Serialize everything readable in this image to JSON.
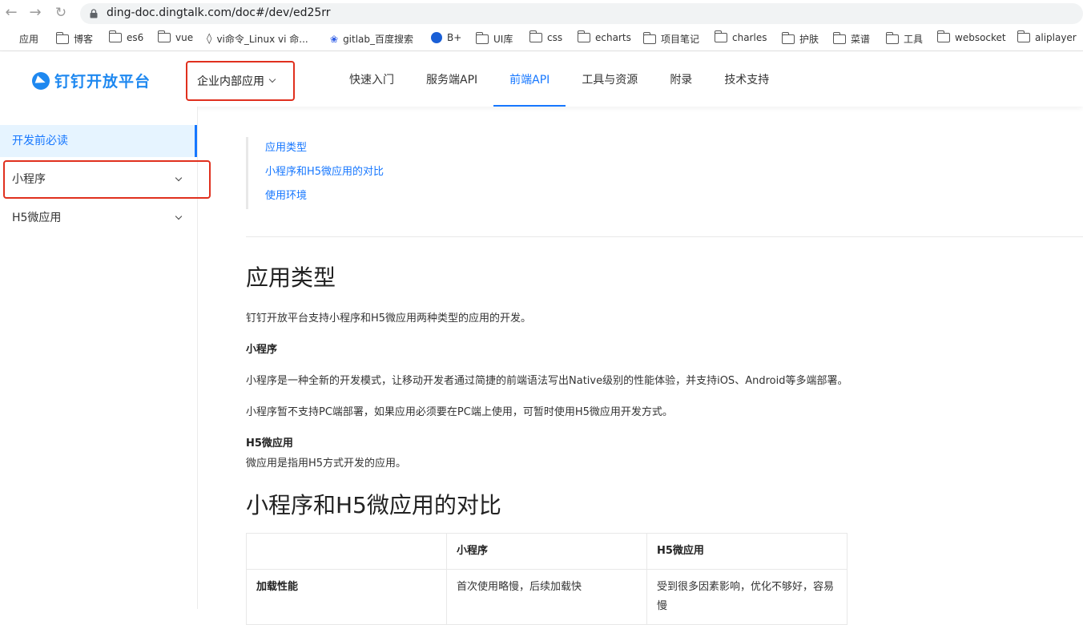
{
  "browser": {
    "url": "ding-doc.dingtalk.com/doc#/dev/ed25rr",
    "bookmarks": [
      {
        "label": "应用",
        "icon": "apps-icon"
      },
      {
        "label": "博客",
        "icon": "folder-icon"
      },
      {
        "label": "es6",
        "icon": "folder-icon"
      },
      {
        "label": "vue",
        "icon": "folder-icon"
      },
      {
        "label": "vi命令_Linux vi 命...",
        "icon": "diamond-icon"
      },
      {
        "label": "gitlab_百度搜索",
        "icon": "baidu-paw-icon"
      },
      {
        "label": "B+",
        "icon": "globe-icon"
      },
      {
        "label": "UI库",
        "icon": "folder-icon"
      },
      {
        "label": "css",
        "icon": "folder-icon"
      },
      {
        "label": "echarts",
        "icon": "folder-icon"
      },
      {
        "label": "项目笔记",
        "icon": "folder-icon"
      },
      {
        "label": "charles",
        "icon": "folder-icon"
      },
      {
        "label": "护肤",
        "icon": "folder-icon"
      },
      {
        "label": "菜谱",
        "icon": "folder-icon"
      },
      {
        "label": "工具",
        "icon": "folder-icon"
      },
      {
        "label": "websocket",
        "icon": "folder-icon"
      },
      {
        "label": "aliplayer",
        "icon": "folder-icon"
      }
    ]
  },
  "header": {
    "logo_text": "钉钉开放平台",
    "app_type": "企业内部应用",
    "nav": [
      {
        "label": "快速入门",
        "active": false
      },
      {
        "label": "服务端API",
        "active": false
      },
      {
        "label": "前端API",
        "active": true
      },
      {
        "label": "工具与资源",
        "active": false
      },
      {
        "label": "附录",
        "active": false
      },
      {
        "label": "技术支持",
        "active": false
      }
    ]
  },
  "sidebar": {
    "items": [
      {
        "label": "开发前必读",
        "active": true
      },
      {
        "label": "小程序",
        "expandable": true
      },
      {
        "label": "H5微应用",
        "expandable": true
      }
    ]
  },
  "content": {
    "toc": [
      "应用类型",
      "小程序和H5微应用的对比",
      "使用环境"
    ],
    "section1_title": "应用类型",
    "section1_intro": "钉钉开放平台支持小程序和H5微应用两种类型的应用的开发。",
    "mini_heading": "小程序",
    "mini_p1": "小程序是一种全新的开发模式，让移动开发者通过简捷的前端语法写出Native级别的性能体验，并支持iOS、Android等多端部署。",
    "mini_p2": "小程序暂不支持PC端部署，如果应用必须要在PC端上使用，可暂时使用H5微应用开发方式。",
    "h5_heading": "H5微应用",
    "h5_p1": "微应用是指用H5方式开发的应用。",
    "section2_title": "小程序和H5微应用的对比",
    "table": {
      "headers": [
        "",
        "小程序",
        "H5微应用"
      ],
      "rows": [
        [
          "加载性能",
          "首次使用略慢，后续加载快",
          "受到很多因素影响，优化不够好，容易慢"
        ]
      ]
    }
  },
  "colors": {
    "accent": "#1677ff",
    "highlight": "#e0301e"
  }
}
